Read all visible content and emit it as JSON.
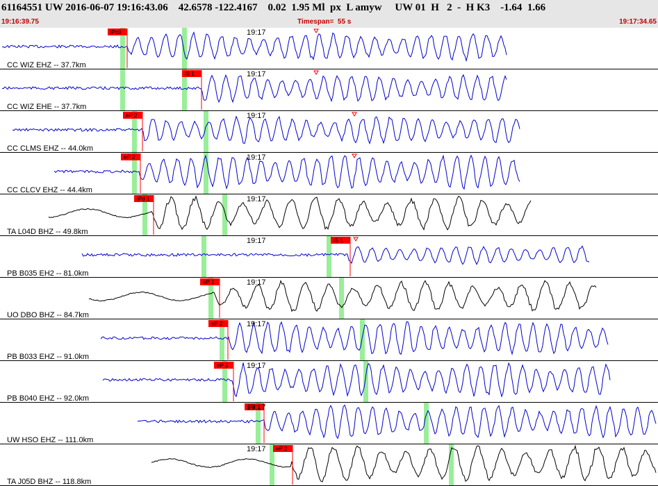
{
  "header": {
    "title": "61164551 UW 2016-06-07 19:16:43.06    42.6578 -122.4167    0.02  1.95 Ml  px  L amyw     UW 01  H   2  -  H K3    -1.64  1.66",
    "start_time": "19:16:39.75",
    "timespan": "Timespan=  55 s",
    "end_time": "19:17:34.65"
  },
  "colors": {
    "blue_trace": "#0000cc",
    "black_trace": "#000000",
    "pick_red": "#ff0000",
    "green_marker": "#99ee99",
    "separator": "#000000"
  },
  "panels": [
    {
      "label": "CC WIZ EHZ -- 37.7km",
      "time_label": "19:17",
      "pick": "iPc0",
      "color": "blue"
    },
    {
      "label": "CC WIZ EHE -- 37.7km",
      "time_label": "19:17",
      "pick": "iS 1",
      "color": "blue"
    },
    {
      "label": "CC CLMS EHZ -- 44.0km",
      "time_label": "19:17",
      "pick": "eP 2",
      "color": "blue"
    },
    {
      "label": "CC CLCV EHZ -- 44.4km",
      "time_label": "19:17",
      "pick": "eP 2",
      "color": "blue"
    },
    {
      "label": "TA L04D BHZ -- 49.8km",
      "time_label": "19:17",
      "pick": "iPd 1",
      "color": "black"
    },
    {
      "label": "PB B035 EH2 -- 81.0km",
      "time_label": "19:17",
      "pick": "iS 1",
      "color": "blue"
    },
    {
      "label": "UO DBO BHZ -- 84.7km",
      "time_label": "19:17",
      "pick": "eP 2",
      "color": "black"
    },
    {
      "label": "PB B033 EHZ -- 91.0km",
      "time_label": "19:17",
      "pick": "eP 2",
      "color": "blue"
    },
    {
      "label": "PB B040 EHZ -- 92.0km",
      "time_label": "19:17",
      "pick": "eP 2",
      "color": "blue"
    },
    {
      "label": "UW HSO EHZ -- 111.0km",
      "time_label": "19:17",
      "pick": "iPd 1",
      "color": "blue"
    },
    {
      "label": "TA J05D BHZ -- 118.8km",
      "time_label": "19:17",
      "pick": "eP 2",
      "color": "black"
    }
  ]
}
